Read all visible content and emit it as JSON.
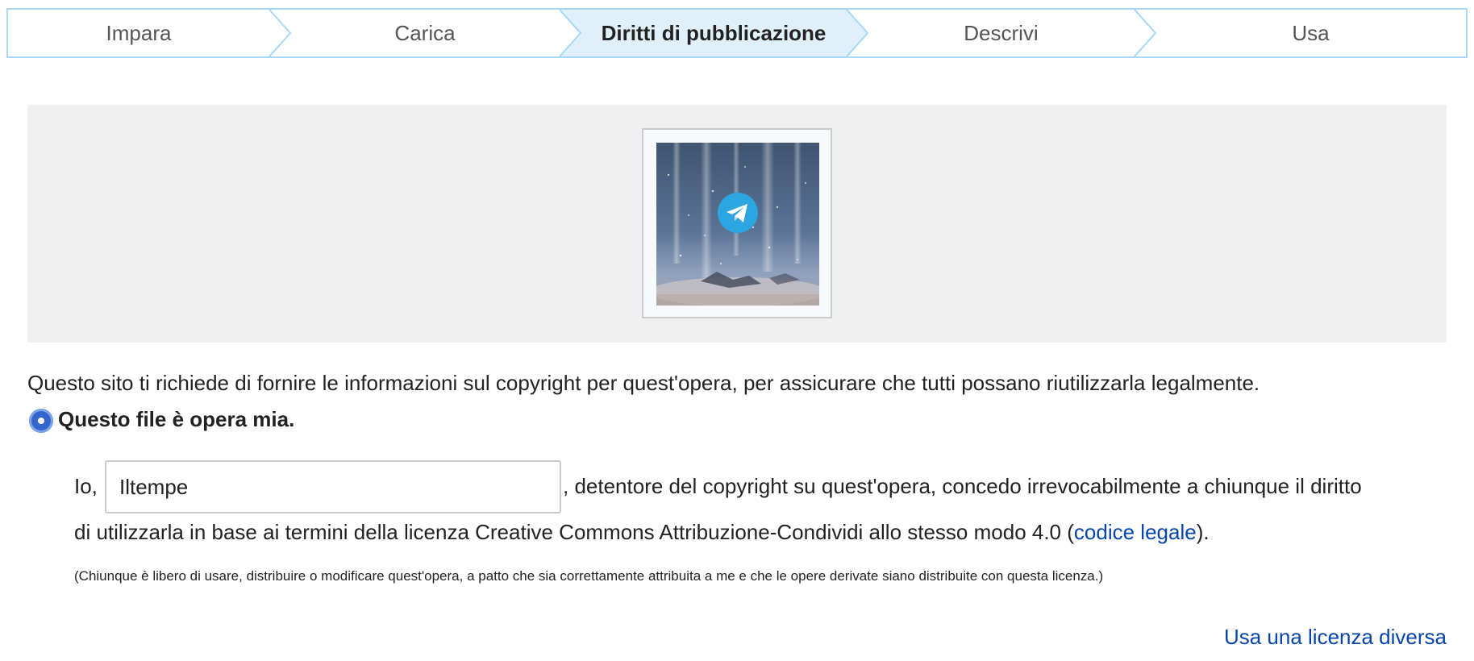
{
  "steps": [
    {
      "label": "Impara",
      "active": false
    },
    {
      "label": "Carica",
      "active": false
    },
    {
      "label": "Diritti di pubblicazione",
      "active": true
    },
    {
      "label": "Descrivi",
      "active": false
    },
    {
      "label": "Usa",
      "active": false
    }
  ],
  "preview": {
    "thumbnail_icon": "telegram-paper-plane-icon"
  },
  "intro_text": "Questo sito ti richiede di fornire le informazioni sul copyright per quest'opera, per assicurare che tutti possano riutilizzarla legalmente.",
  "own_work": {
    "selected": true,
    "label": "Questo file è opera mia."
  },
  "declaration": {
    "prefix": "Io,",
    "author_value": "Iltempe",
    "line1_rest": ", detentore del copyright su quest'opera, concedo irrevocabilmente a chiunque il diritto",
    "line2_text": "di utilizzarla in base ai termini della licenza Creative Commons Attribuzione-Condividi allo stesso modo 4.0 (",
    "legal_link": "codice legale",
    "line2_end": ").",
    "note": "(Chiunque è libero di usare, distribuire o modificare quest'opera, a patto che sia correttamente attribuita a me e che le opere derivate siano distribuite con questa licenza.)"
  },
  "other_license_link": "Usa una licenza diversa",
  "colors": {
    "accent": "#3366cc",
    "link": "#0645ad",
    "stepper_border": "#a7d7f9",
    "active_step_bg": "#e0f0fa"
  }
}
